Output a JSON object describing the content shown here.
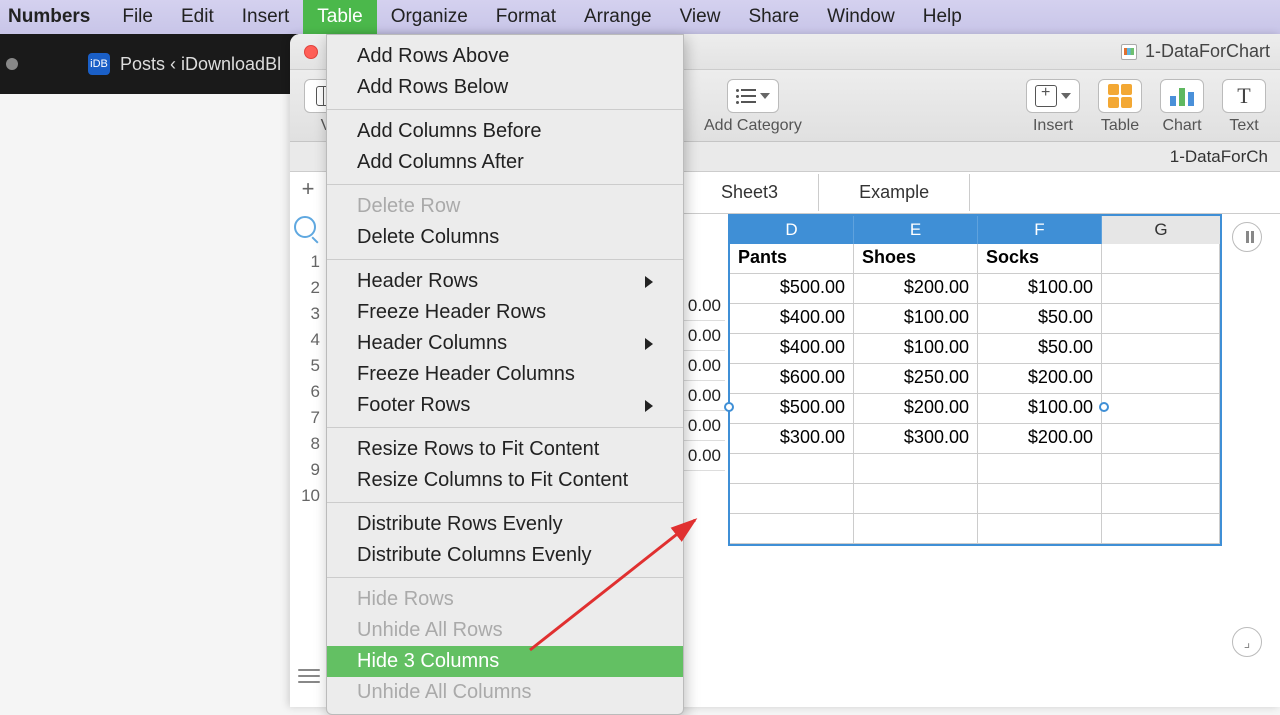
{
  "menubar": {
    "app": "Numbers",
    "items": [
      "File",
      "Edit",
      "Insert",
      "Table",
      "Organize",
      "Format",
      "Arrange",
      "View",
      "Share",
      "Window",
      "Help"
    ],
    "open_index": 3
  },
  "browser_tab": {
    "favicon_text": "iDB",
    "title": "Posts ‹ iDownloadBl"
  },
  "window": {
    "doc_title": "1-DataForChart",
    "subtitle": "1-DataForCh"
  },
  "toolbar": {
    "view": "V",
    "add_category": "Add Category",
    "insert": "Insert",
    "table": "Table",
    "chart": "Chart",
    "text": "Text"
  },
  "sheet_tabs": [
    "Sheet3",
    "Example"
  ],
  "row_numbers": [
    "1",
    "2",
    "3",
    "4",
    "5",
    "6",
    "7",
    "8",
    "9",
    "10"
  ],
  "col_letters": [
    "D",
    "E",
    "F",
    "G"
  ],
  "ghost_values": [
    "0.00",
    "0.00",
    "0.00",
    "0.00",
    "0.00",
    "0.00"
  ],
  "table": {
    "headers": [
      "Pants",
      "Shoes",
      "Socks",
      ""
    ],
    "rows": [
      [
        "$500.00",
        "$200.00",
        "$100.00",
        ""
      ],
      [
        "$400.00",
        "$100.00",
        "$50.00",
        ""
      ],
      [
        "$400.00",
        "$100.00",
        "$50.00",
        ""
      ],
      [
        "$600.00",
        "$250.00",
        "$200.00",
        ""
      ],
      [
        "$500.00",
        "$200.00",
        "$100.00",
        ""
      ],
      [
        "$300.00",
        "$300.00",
        "$200.00",
        ""
      ],
      [
        "",
        "",
        "",
        ""
      ],
      [
        "",
        "",
        "",
        ""
      ],
      [
        "",
        "",
        "",
        ""
      ]
    ]
  },
  "dropdown": {
    "groups": [
      [
        {
          "label": "Add Rows Above"
        },
        {
          "label": "Add Rows Below"
        }
      ],
      [
        {
          "label": "Add Columns Before"
        },
        {
          "label": "Add Columns After"
        }
      ],
      [
        {
          "label": "Delete Row",
          "disabled": true
        },
        {
          "label": "Delete Columns"
        }
      ],
      [
        {
          "label": "Header Rows",
          "submenu": true
        },
        {
          "label": "Freeze Header Rows"
        },
        {
          "label": "Header Columns",
          "submenu": true
        },
        {
          "label": "Freeze Header Columns"
        },
        {
          "label": "Footer Rows",
          "submenu": true
        }
      ],
      [
        {
          "label": "Resize Rows to Fit Content"
        },
        {
          "label": "Resize Columns to Fit Content"
        }
      ],
      [
        {
          "label": "Distribute Rows Evenly"
        },
        {
          "label": "Distribute Columns Evenly"
        }
      ],
      [
        {
          "label": "Hide Rows",
          "disabled": true
        },
        {
          "label": "Unhide All Rows",
          "disabled": true
        },
        {
          "label": "Hide 3 Columns",
          "highlight": true
        },
        {
          "label": "Unhide All Columns",
          "disabled": true
        }
      ]
    ]
  }
}
